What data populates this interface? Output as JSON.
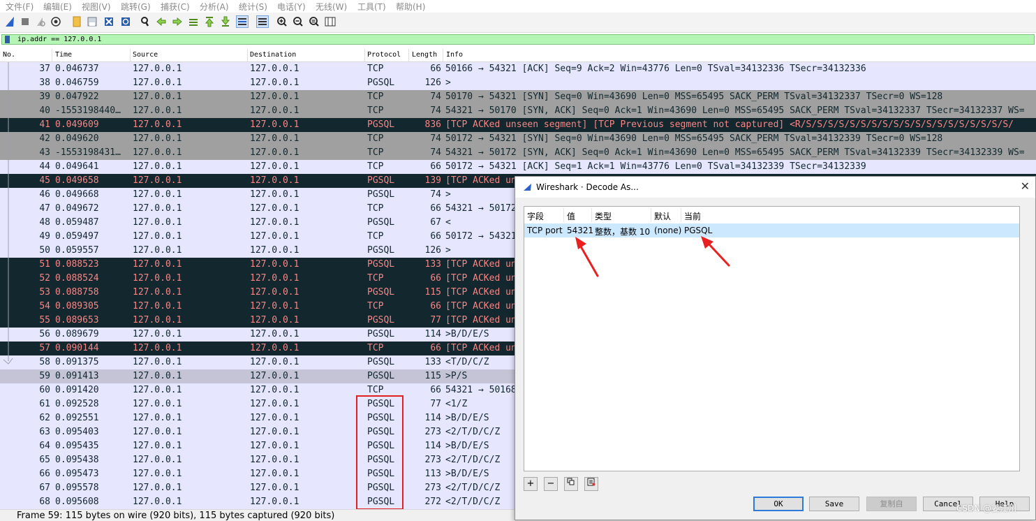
{
  "menu": [
    "文件(F)",
    "编辑(E)",
    "视图(V)",
    "跳转(G)",
    "捕获(C)",
    "分析(A)",
    "统计(S)",
    "电话(Y)",
    "无线(W)",
    "工具(T)",
    "帮助(H)"
  ],
  "filter": {
    "value": "ip.addr == 127.0.0.1"
  },
  "columns": {
    "no": "No.",
    "time": "Time",
    "source": "Source",
    "destination": "Destination",
    "protocol": "Protocol",
    "length": "Length",
    "info": "Info"
  },
  "colors": {
    "tcp_row": "#e7e6ff",
    "gray_row": "#a0a0a0",
    "dark_row": "#12272e",
    "dark_text": "#f78787",
    "filter_ok": "#b5f5b5",
    "highlight_red": "#e02020",
    "dialog_selection": "#cce8ff"
  },
  "packets": [
    {
      "no": "37",
      "time": "0.046737",
      "src": "127.0.0.1",
      "dst": "127.0.0.1",
      "proto": "TCP",
      "len": "66",
      "info": "50166 → 54321 [ACK] Seq=9 Ack=2 Win=43776 Len=0 TSval=34132336 TSecr=34132336",
      "style": "c-tcp"
    },
    {
      "no": "38",
      "time": "0.046759",
      "src": "127.0.0.1",
      "dst": "127.0.0.1",
      "proto": "PGSQL",
      "len": "126",
      "info": ">",
      "style": "c-pg"
    },
    {
      "no": "39",
      "time": "0.047922",
      "src": "127.0.0.1",
      "dst": "127.0.0.1",
      "proto": "TCP",
      "len": "74",
      "info": "50170 → 54321 [SYN] Seq=0 Win=43690 Len=0 MSS=65495 SACK_PERM TSval=34132337 TSecr=0 WS=128",
      "style": "c-gray"
    },
    {
      "no": "40",
      "time": "-1553198440…",
      "src": "127.0.0.1",
      "dst": "127.0.0.1",
      "proto": "TCP",
      "len": "74",
      "info": "54321 → 50170 [SYN, ACK] Seq=0 Ack=1 Win=43690 Len=0 MSS=65495 SACK_PERM TSval=34132337 TSecr=34132337 WS=",
      "style": "c-gray"
    },
    {
      "no": "41",
      "time": "0.049609",
      "src": "127.0.0.1",
      "dst": "127.0.0.1",
      "proto": "PGSQL",
      "len": "836",
      "info": "[TCP ACKed unseen segment] [TCP Previous segment not captured] <R/S/S/S/S/S/S/S/S/S/S/S/S/S/S/S/S/S/S/S/",
      "style": "c-dark"
    },
    {
      "no": "42",
      "time": "0.049620",
      "src": "127.0.0.1",
      "dst": "127.0.0.1",
      "proto": "TCP",
      "len": "74",
      "info": "50172 → 54321 [SYN] Seq=0 Win=43690 Len=0 MSS=65495 SACK_PERM TSval=34132339 TSecr=0 WS=128",
      "style": "c-gray"
    },
    {
      "no": "43",
      "time": "-1553198431…",
      "src": "127.0.0.1",
      "dst": "127.0.0.1",
      "proto": "TCP",
      "len": "74",
      "info": "54321 → 50172 [SYN, ACK] Seq=0 Ack=1 Win=43690 Len=0 MSS=65495 SACK_PERM TSval=34132339 TSecr=34132339 WS=",
      "style": "c-gray"
    },
    {
      "no": "44",
      "time": "0.049641",
      "src": "127.0.0.1",
      "dst": "127.0.0.1",
      "proto": "TCP",
      "len": "66",
      "info": "50172 → 54321 [ACK] Seq=1 Ack=1 Win=43776 Len=0 TSval=34132339 TSecr=34132339",
      "style": "c-tcp"
    },
    {
      "no": "45",
      "time": "0.049658",
      "src": "127.0.0.1",
      "dst": "127.0.0.1",
      "proto": "PGSQL",
      "len": "139",
      "info": "[TCP ACKed un",
      "style": "c-dark"
    },
    {
      "no": "46",
      "time": "0.049668",
      "src": "127.0.0.1",
      "dst": "127.0.0.1",
      "proto": "PGSQL",
      "len": "74",
      "info": ">",
      "style": "c-pg"
    },
    {
      "no": "47",
      "time": "0.049672",
      "src": "127.0.0.1",
      "dst": "127.0.0.1",
      "proto": "TCP",
      "len": "66",
      "info": "54321 → 50172",
      "style": "c-tcp"
    },
    {
      "no": "48",
      "time": "0.059487",
      "src": "127.0.0.1",
      "dst": "127.0.0.1",
      "proto": "PGSQL",
      "len": "67",
      "info": "<",
      "style": "c-pg"
    },
    {
      "no": "49",
      "time": "0.059497",
      "src": "127.0.0.1",
      "dst": "127.0.0.1",
      "proto": "TCP",
      "len": "66",
      "info": "50172 → 54321",
      "style": "c-tcp"
    },
    {
      "no": "50",
      "time": "0.059557",
      "src": "127.0.0.1",
      "dst": "127.0.0.1",
      "proto": "PGSQL",
      "len": "126",
      "info": ">",
      "style": "c-pg"
    },
    {
      "no": "51",
      "time": "0.088523",
      "src": "127.0.0.1",
      "dst": "127.0.0.1",
      "proto": "PGSQL",
      "len": "133",
      "info": "[TCP ACKed un",
      "style": "c-dark"
    },
    {
      "no": "52",
      "time": "0.088524",
      "src": "127.0.0.1",
      "dst": "127.0.0.1",
      "proto": "TCP",
      "len": "66",
      "info": "[TCP ACKed un",
      "style": "c-dark"
    },
    {
      "no": "53",
      "time": "0.088758",
      "src": "127.0.0.1",
      "dst": "127.0.0.1",
      "proto": "PGSQL",
      "len": "115",
      "info": "[TCP ACKed un",
      "style": "c-dark"
    },
    {
      "no": "54",
      "time": "0.089305",
      "src": "127.0.0.1",
      "dst": "127.0.0.1",
      "proto": "TCP",
      "len": "66",
      "info": "[TCP ACKed un",
      "style": "c-dark"
    },
    {
      "no": "55",
      "time": "0.089653",
      "src": "127.0.0.1",
      "dst": "127.0.0.1",
      "proto": "PGSQL",
      "len": "77",
      "info": "[TCP ACKed un",
      "style": "c-dark"
    },
    {
      "no": "56",
      "time": "0.089679",
      "src": "127.0.0.1",
      "dst": "127.0.0.1",
      "proto": "PGSQL",
      "len": "114",
      "info": ">B/D/E/S",
      "style": "c-pg"
    },
    {
      "no": "57",
      "time": "0.090144",
      "src": "127.0.0.1",
      "dst": "127.0.0.1",
      "proto": "TCP",
      "len": "66",
      "info": "[TCP ACKed un",
      "style": "c-dark"
    },
    {
      "no": "58",
      "time": "0.091375",
      "src": "127.0.0.1",
      "dst": "127.0.0.1",
      "proto": "PGSQL",
      "len": "133",
      "info": "<T/D/C/Z",
      "style": "c-pg"
    },
    {
      "no": "59",
      "time": "0.091413",
      "src": "127.0.0.1",
      "dst": "127.0.0.1",
      "proto": "PGSQL",
      "len": "115",
      "info": ">P/S",
      "style": "c-sel"
    },
    {
      "no": "60",
      "time": "0.091420",
      "src": "127.0.0.1",
      "dst": "127.0.0.1",
      "proto": "TCP",
      "len": "66",
      "info": "54321 → 50168",
      "style": "c-tcp"
    },
    {
      "no": "61",
      "time": "0.092528",
      "src": "127.0.0.1",
      "dst": "127.0.0.1",
      "proto": "PGSQL",
      "len": "77",
      "info": "<1/Z",
      "style": "c-pg"
    },
    {
      "no": "62",
      "time": "0.092551",
      "src": "127.0.0.1",
      "dst": "127.0.0.1",
      "proto": "PGSQL",
      "len": "114",
      "info": ">B/D/E/S",
      "style": "c-pg"
    },
    {
      "no": "63",
      "time": "0.095403",
      "src": "127.0.0.1",
      "dst": "127.0.0.1",
      "proto": "PGSQL",
      "len": "273",
      "info": "<2/T/D/C/Z",
      "style": "c-pg"
    },
    {
      "no": "64",
      "time": "0.095435",
      "src": "127.0.0.1",
      "dst": "127.0.0.1",
      "proto": "PGSQL",
      "len": "114",
      "info": ">B/D/E/S",
      "style": "c-pg"
    },
    {
      "no": "65",
      "time": "0.095438",
      "src": "127.0.0.1",
      "dst": "127.0.0.1",
      "proto": "PGSQL",
      "len": "273",
      "info": "<2/T/D/C/Z",
      "style": "c-pg"
    },
    {
      "no": "66",
      "time": "0.095473",
      "src": "127.0.0.1",
      "dst": "127.0.0.1",
      "proto": "PGSQL",
      "len": "113",
      "info": ">B/D/E/S",
      "style": "c-pg"
    },
    {
      "no": "67",
      "time": "0.095578",
      "src": "127.0.0.1",
      "dst": "127.0.0.1",
      "proto": "PGSQL",
      "len": "273",
      "info": "<2/T/D/C/Z",
      "style": "c-pg"
    },
    {
      "no": "68",
      "time": "0.095608",
      "src": "127.0.0.1",
      "dst": "127.0.0.1",
      "proto": "PGSQL",
      "len": "272",
      "info": "<2/T/D/C/Z",
      "style": "c-pg"
    }
  ],
  "status": {
    "text": "Frame 59: 115 bytes on wire (920 bits), 115 bytes captured (920 bits)"
  },
  "dialog": {
    "title": "Wireshark · Decode As...",
    "columns": {
      "field": "字段",
      "value": "值",
      "type": "类型",
      "default": "默认",
      "current": "当前"
    },
    "row": {
      "field": "TCP port",
      "value": "54321",
      "type": "整数，基数 10",
      "default": "(none)",
      "current": "PGSQL"
    },
    "buttons": {
      "ok": "OK",
      "save": "Save",
      "copy_from": "复制自",
      "cancel": "Cancel",
      "help": "Help"
    }
  },
  "watermark": "CSDN @姜江州"
}
